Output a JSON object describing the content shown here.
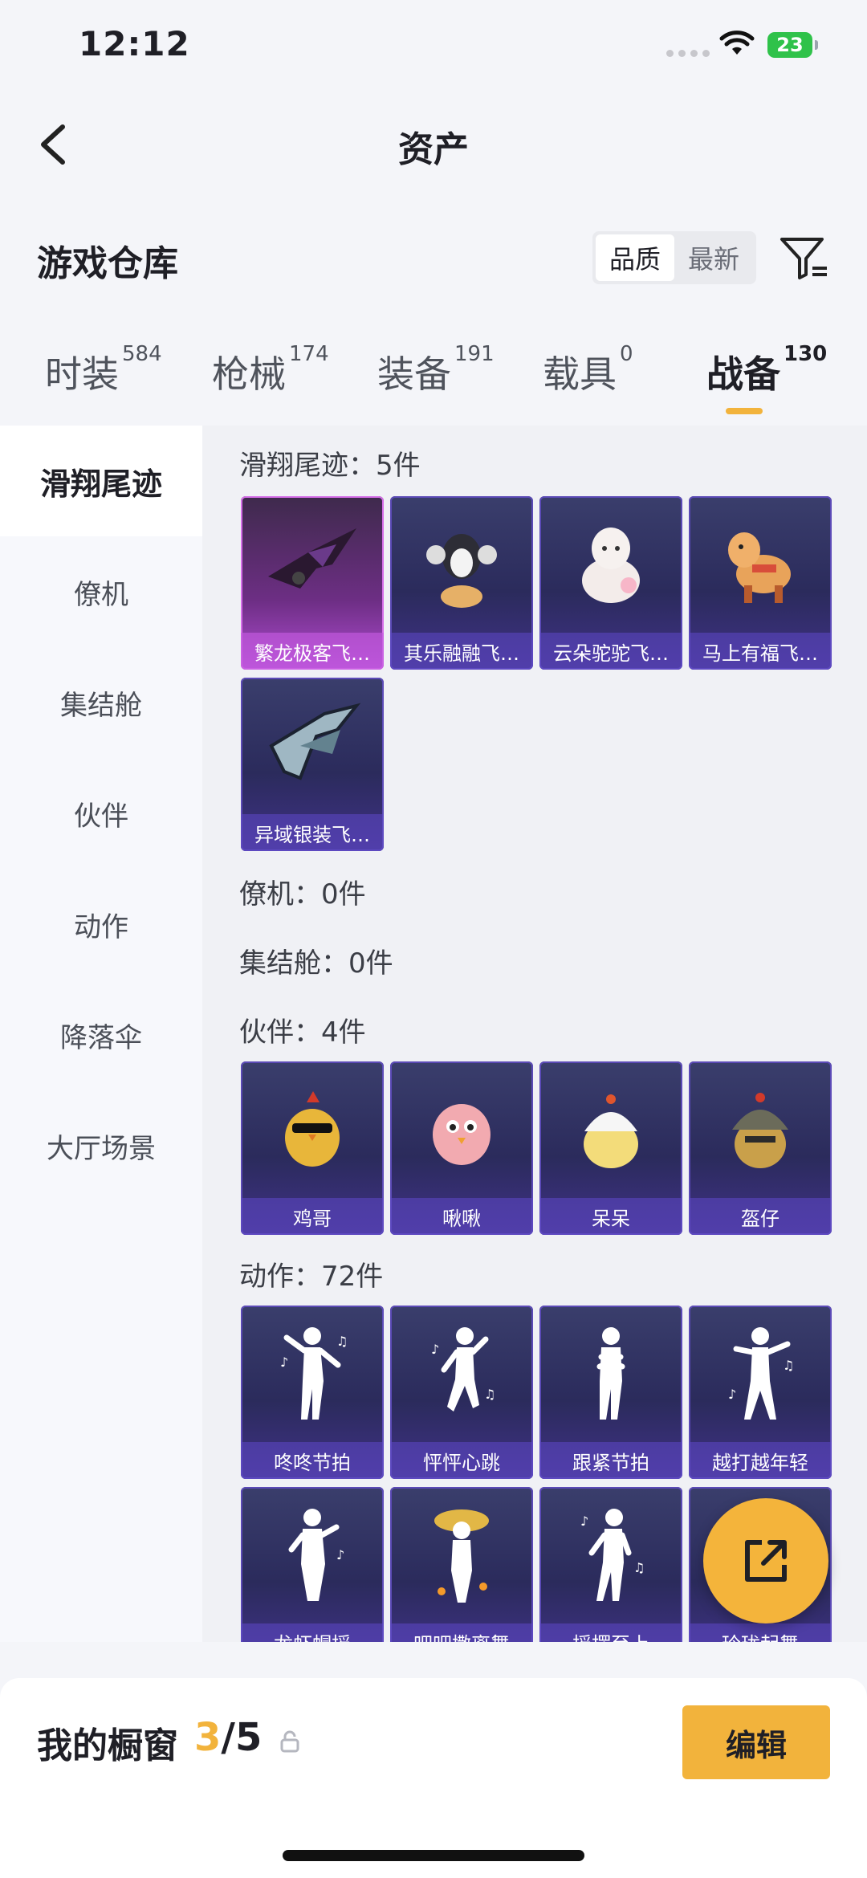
{
  "status": {
    "time": "12:12",
    "battery": "23"
  },
  "nav": {
    "title": "资产"
  },
  "warehouse": {
    "title": "游戏仓库",
    "sort_options": [
      "品质",
      "最新"
    ]
  },
  "tabs": [
    {
      "label": "时装",
      "count": "584"
    },
    {
      "label": "枪械",
      "count": "174"
    },
    {
      "label": "装备",
      "count": "191"
    },
    {
      "label": "载具",
      "count": "0"
    },
    {
      "label": "战备",
      "count": "130"
    }
  ],
  "sidebar": [
    "滑翔尾迹",
    "僚机",
    "集结舱",
    "伙伴",
    "动作",
    "降落伞",
    "大厅场景"
  ],
  "sections": {
    "trail": {
      "title": "滑翔尾迹：5件",
      "items": [
        "繁龙极客飞…",
        "其乐融融飞…",
        "云朵驼驼飞…",
        "马上有福飞…",
        "异域银装飞…"
      ]
    },
    "wingman": {
      "title": "僚机：0件"
    },
    "pod": {
      "title": "集结舱：0件"
    },
    "partner": {
      "title": "伙伴：4件",
      "items": [
        "鸡哥",
        "啾啾",
        "呆呆",
        "盔仔"
      ]
    },
    "emote": {
      "title": "动作：72件",
      "items": [
        "咚咚节拍",
        "怦怦心跳",
        "跟紧节拍",
        "越打越年轻",
        "龙虾帽摇",
        "吧吧撒离舞",
        "摇摆至上",
        "玲珑起舞"
      ]
    }
  },
  "showcase": {
    "label": "我的橱窗",
    "current": "3",
    "total": "/5"
  },
  "edit_label": "编辑",
  "colors": {
    "accent": "#f2b33c",
    "card_purple": "#b04cd2",
    "card_blue": "#403187"
  }
}
